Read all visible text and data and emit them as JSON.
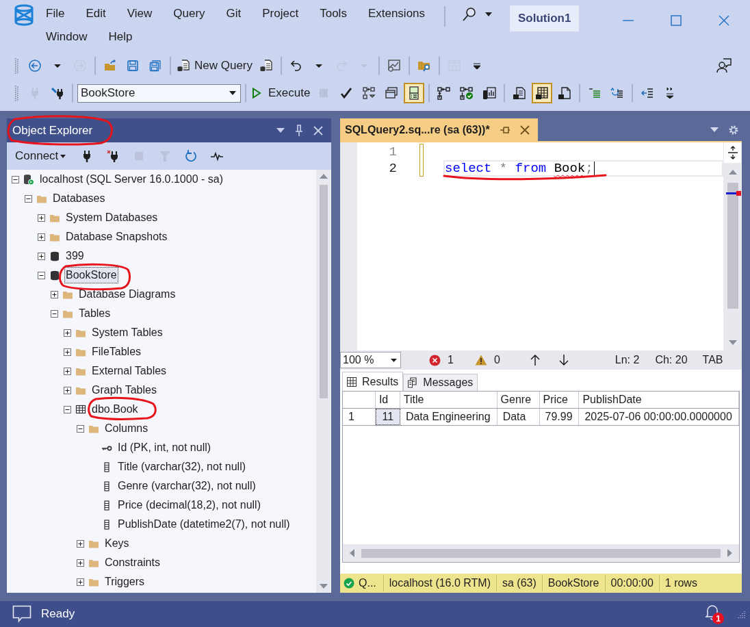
{
  "menu": [
    "File",
    "Edit",
    "View",
    "Query",
    "Git",
    "Project",
    "Tools",
    "Extensions",
    "Window",
    "Help"
  ],
  "title_bar": {
    "solution": "Solution1"
  },
  "toolbars": [
    {
      "groups": [
        [
          {
            "kind": "back",
            "disabled": false
          },
          {
            "kind": "dropdown",
            "disabled": false
          },
          {
            "kind": "forward",
            "disabled": true
          }
        ],
        [
          {
            "kind": "open",
            "disabled": false
          },
          {
            "kind": "save",
            "disabled": false
          },
          {
            "kind": "save-all",
            "disabled": false
          }
        ],
        [
          {
            "kind": "new-query",
            "label": "New Query",
            "disabled": false
          },
          {
            "kind": "database-query",
            "disabled": false
          }
        ],
        [
          {
            "kind": "undo",
            "disabled": false
          },
          {
            "kind": "dropdown",
            "disabled": false
          },
          {
            "kind": "redo",
            "disabled": true
          },
          {
            "kind": "dropdown",
            "disabled": true
          }
        ],
        [
          {
            "kind": "activity",
            "disabled": false
          }
        ],
        [
          {
            "kind": "folder-search",
            "disabled": false
          }
        ],
        [
          {
            "kind": "window",
            "disabled": true
          },
          {
            "kind": "overflow",
            "disabled": false
          }
        ]
      ]
    },
    {
      "groups": [
        [
          {
            "kind": "connect",
            "disabled": true
          },
          {
            "kind": "change-connection",
            "disabled": false
          }
        ],
        [
          {
            "kind": "database-select",
            "value": "BookStore",
            "disabled": false
          }
        ],
        [
          {
            "kind": "execute",
            "label": "Execute",
            "disabled": false
          },
          {
            "kind": "stop",
            "disabled": true
          },
          {
            "kind": "parse",
            "disabled": false
          },
          {
            "kind": "plan",
            "disabled": false
          },
          {
            "kind": "windows",
            "disabled": false
          },
          {
            "kind": "results-pane",
            "disabled": false,
            "checked": true
          }
        ],
        [
          {
            "kind": "live-plan",
            "disabled": false
          },
          {
            "kind": "plan-check",
            "disabled": false
          },
          {
            "kind": "stats",
            "disabled": false
          }
        ],
        [
          {
            "kind": "results-text",
            "disabled": false
          },
          {
            "kind": "results-grid",
            "disabled": false,
            "checked": true
          },
          {
            "kind": "results-file",
            "disabled": false
          }
        ],
        [
          {
            "kind": "indent",
            "disabled": false
          },
          {
            "kind": "uncomment",
            "disabled": false
          }
        ],
        [
          {
            "kind": "outdent",
            "disabled": false
          },
          {
            "kind": "overflow-small",
            "disabled": false
          }
        ]
      ]
    }
  ],
  "object_explorer": {
    "title": "Object Explorer",
    "connect": "Connect",
    "buttons": [
      {
        "kind": "connect",
        "disabled": false
      },
      {
        "kind": "disconnect",
        "disabled": false
      },
      {
        "kind": "stop",
        "disabled": true
      },
      {
        "kind": "filter",
        "disabled": true
      },
      {
        "kind": "refresh",
        "disabled": false
      },
      {
        "kind": "activity-pulse",
        "disabled": false
      }
    ],
    "tree": [
      {
        "label": "localhost (SQL Server 16.0.1000 - sa)",
        "kind": "server",
        "expanded": true,
        "selected": false,
        "children": [
          {
            "label": "Databases",
            "kind": "folder",
            "expanded": true,
            "selected": false,
            "children": [
              {
                "label": "System Databases",
                "kind": "folder",
                "expanded": false,
                "selected": false
              },
              {
                "label": "Database Snapshots",
                "kind": "folder",
                "expanded": false,
                "selected": false
              },
              {
                "label": "399",
                "kind": "database",
                "expanded": false,
                "selected": false
              },
              {
                "label": "BookStore",
                "kind": "database",
                "expanded": true,
                "selected": true,
                "children": [
                  {
                    "label": "Database Diagrams",
                    "kind": "folder",
                    "expanded": false,
                    "selected": false
                  },
                  {
                    "label": "Tables",
                    "kind": "folder",
                    "expanded": true,
                    "selected": false,
                    "children": [
                      {
                        "label": "System Tables",
                        "kind": "folder",
                        "expanded": false,
                        "selected": false
                      },
                      {
                        "label": "FileTables",
                        "kind": "folder",
                        "expanded": false,
                        "selected": false
                      },
                      {
                        "label": "External Tables",
                        "kind": "folder",
                        "expanded": false,
                        "selected": false
                      },
                      {
                        "label": "Graph Tables",
                        "kind": "folder",
                        "expanded": false,
                        "selected": false
                      },
                      {
                        "label": "dbo.Book",
                        "kind": "table",
                        "expanded": true,
                        "selected": false,
                        "children": [
                          {
                            "label": "Columns",
                            "kind": "folder",
                            "expanded": true,
                            "selected": false,
                            "children": [
                              {
                                "label": "Id (PK, int, not null)",
                                "kind": "key-column",
                                "selected": false
                              },
                              {
                                "label": "Title (varchar(32), not null)",
                                "kind": "column",
                                "selected": false
                              },
                              {
                                "label": "Genre (varchar(32), not null)",
                                "kind": "column",
                                "selected": false
                              },
                              {
                                "label": "Price (decimal(18,2), not null)",
                                "kind": "column",
                                "selected": false
                              },
                              {
                                "label": "PublishDate (datetime2(7), not null)",
                                "kind": "column",
                                "selected": false
                              }
                            ]
                          },
                          {
                            "label": "Keys",
                            "kind": "folder",
                            "expanded": false,
                            "selected": false
                          },
                          {
                            "label": "Constraints",
                            "kind": "folder",
                            "expanded": false,
                            "selected": false
                          },
                          {
                            "label": "Triggers",
                            "kind": "folder",
                            "expanded": false,
                            "selected": false
                          }
                        ]
                      }
                    ]
                  }
                ]
              }
            ]
          }
        ]
      }
    ]
  },
  "editor": {
    "tab": {
      "title": "SQLQuery2.sq...re (sa (63))*"
    },
    "lines": [
      {
        "number": "1",
        "current": false
      },
      {
        "number": "2",
        "current": true,
        "tokens": [
          {
            "text": "select",
            "kind": "keyword"
          },
          {
            "text": " * ",
            "kind": "operator"
          },
          {
            "text": "from ",
            "kind": "keyword"
          },
          {
            "text": "Book",
            "kind": "identifier",
            "error": true
          },
          {
            "text": ";",
            "kind": "operator"
          }
        ]
      }
    ]
  },
  "editor_status": {
    "zoom": "100 %",
    "errors": "1",
    "warnings": "0",
    "line": "Ln: 2",
    "column": "Ch: 20",
    "mode": "TAB"
  },
  "results": {
    "tabs": [
      {
        "label": "Results",
        "selected": true
      },
      {
        "label": "Messages",
        "selected": false
      }
    ],
    "columns": [
      "Id",
      "Title",
      "Genre",
      "Price",
      "PublishDate"
    ],
    "rows": [
      {
        "number": "1",
        "cells": [
          {
            "text": "11",
            "selected": true
          },
          {
            "text": "Data Engineering",
            "selected": false
          },
          {
            "text": "Data",
            "selected": false
          },
          {
            "text": "79.99",
            "selected": false
          },
          {
            "text": "2025-07-06 00:00:00.0000000",
            "selected": false
          }
        ]
      }
    ]
  },
  "query_status": {
    "state": "Q...",
    "success": true,
    "items": [
      "localhost (16.0 RTM)",
      "sa (63)",
      "BookStore",
      "00:00:00",
      "1 rows"
    ]
  },
  "status_bar": {
    "text": "Ready",
    "notifications": "1"
  }
}
